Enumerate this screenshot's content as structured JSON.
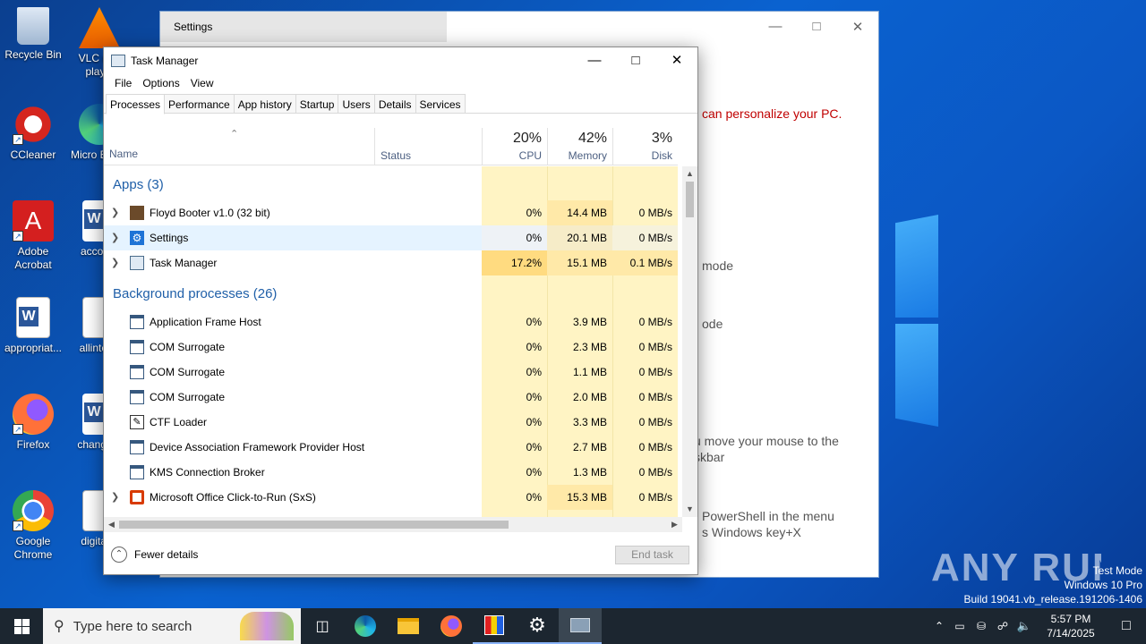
{
  "desktop": {
    "icons": [
      {
        "label": "Recycle Bin",
        "name": "recycle-bin-icon"
      },
      {
        "label": "VLC m... play...",
        "name": "vlc-icon"
      },
      {
        "label": "CCleaner",
        "name": "ccleaner-icon"
      },
      {
        "label": "Micro Edg...",
        "name": "edge-desktop-icon"
      },
      {
        "label": "Adobe Acrobat",
        "name": "acrobat-icon"
      },
      {
        "label": "accou...",
        "name": "word-doc-icon"
      },
      {
        "label": "appropriat...",
        "name": "word-doc-icon"
      },
      {
        "label": "allinter...",
        "name": "image-file-icon"
      },
      {
        "label": "Firefox",
        "name": "firefox-icon"
      },
      {
        "label": "change...",
        "name": "word-doc-icon"
      },
      {
        "label": "Google Chrome",
        "name": "chrome-icon"
      },
      {
        "label": "digital...",
        "name": "image-file-icon"
      }
    ],
    "watermark": {
      "line1": "Test Mode",
      "line2": "Windows 10 Pro",
      "line3": "Build 19041.vb_release.191206-1406",
      "brand": "ANY RUN"
    }
  },
  "settings": {
    "title": "Settings",
    "text1": "can personalize your PC.",
    "text2": "mode",
    "text3": "ode",
    "text4a": "u move your mouse to the",
    "text4b": "skbar",
    "text5a": "PowerShell in the menu",
    "text5b": "s Windows key+X"
  },
  "taskmanager": {
    "title": "Task Manager",
    "menu": [
      "File",
      "Options",
      "View"
    ],
    "tabs": [
      "Processes",
      "Performance",
      "App history",
      "Startup",
      "Users",
      "Details",
      "Services"
    ],
    "columns": {
      "name": "Name",
      "status": "Status",
      "cpu_pct": "20%",
      "cpu": "CPU",
      "mem_pct": "42%",
      "mem": "Memory",
      "disk_pct": "3%",
      "disk": "Disk"
    },
    "groups": {
      "apps": "Apps (3)",
      "background": "Background processes (26)"
    },
    "apps": [
      {
        "name": "Floyd Booter v1.0 (32 bit)",
        "cpu": "0%",
        "mem": "14.4 MB",
        "disk": "0 MB/s"
      },
      {
        "name": "Settings",
        "cpu": "0%",
        "mem": "20.1 MB",
        "disk": "0 MB/s"
      },
      {
        "name": "Task Manager",
        "cpu": "17.2%",
        "mem": "15.1 MB",
        "disk": "0.1 MB/s"
      }
    ],
    "background": [
      {
        "name": "Application Frame Host",
        "cpu": "0%",
        "mem": "3.9 MB",
        "disk": "0 MB/s"
      },
      {
        "name": "COM Surrogate",
        "cpu": "0%",
        "mem": "2.3 MB",
        "disk": "0 MB/s"
      },
      {
        "name": "COM Surrogate",
        "cpu": "0%",
        "mem": "1.1 MB",
        "disk": "0 MB/s"
      },
      {
        "name": "COM Surrogate",
        "cpu": "0%",
        "mem": "2.0 MB",
        "disk": "0 MB/s"
      },
      {
        "name": "CTF Loader",
        "cpu": "0%",
        "mem": "3.3 MB",
        "disk": "0 MB/s"
      },
      {
        "name": "Device Association Framework Provider Host",
        "cpu": "0%",
        "mem": "2.7 MB",
        "disk": "0 MB/s"
      },
      {
        "name": "KMS Connection Broker",
        "cpu": "0%",
        "mem": "1.3 MB",
        "disk": "0 MB/s"
      },
      {
        "name": "Microsoft Office Click-to-Run (SxS)",
        "cpu": "0%",
        "mem": "15.3 MB",
        "disk": "0 MB/s"
      }
    ],
    "fewer_details": "Fewer details",
    "end_task": "End task"
  },
  "taskbar": {
    "search_placeholder": "Type here to search",
    "time": "5:57 PM",
    "date": "7/14/2025"
  }
}
